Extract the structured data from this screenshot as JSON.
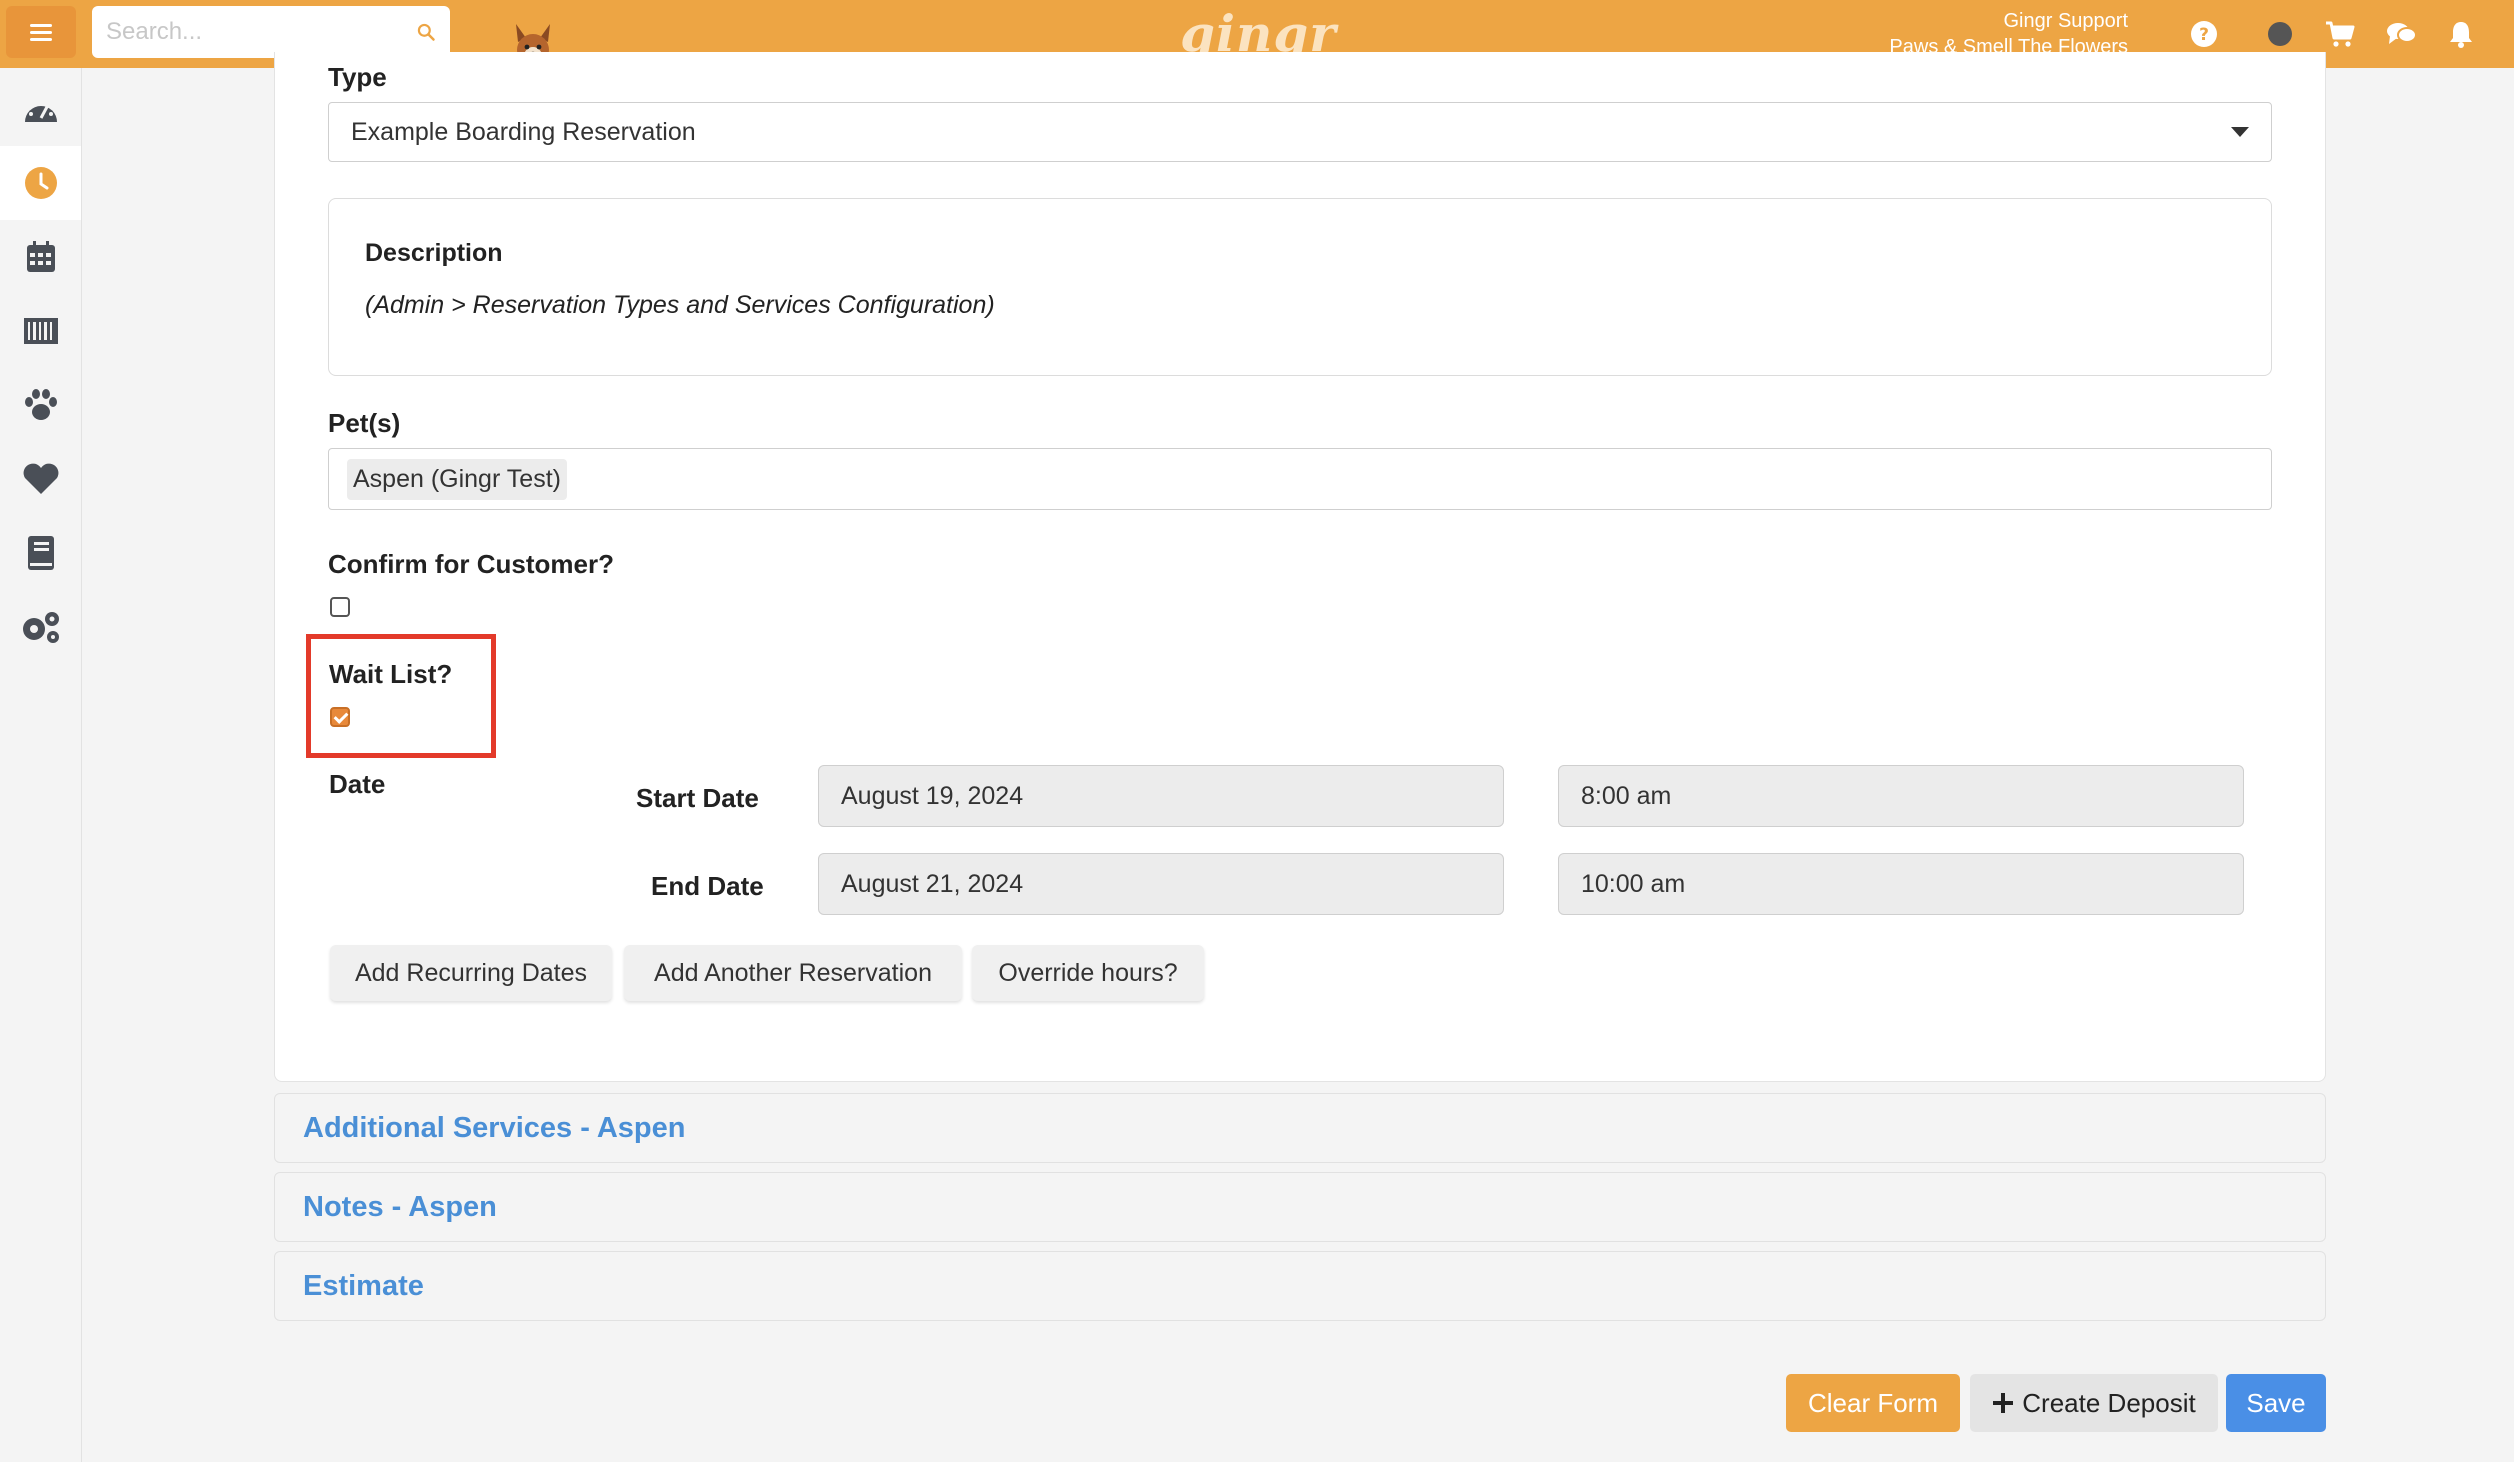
{
  "topbar": {
    "search_placeholder": "Search...",
    "logo": "gingr",
    "user_name": "Gingr Support",
    "business_name": "Paws & Smell The Flowers",
    "accent_color": "#eda544"
  },
  "sidebar": {
    "items": [
      {
        "icon": "dashboard-icon"
      },
      {
        "icon": "clock-icon",
        "active": true
      },
      {
        "icon": "calendar-icon"
      },
      {
        "icon": "barcode-icon"
      },
      {
        "icon": "paw-icon"
      },
      {
        "icon": "heart-icon"
      },
      {
        "icon": "book-icon"
      },
      {
        "icon": "gears-icon"
      }
    ]
  },
  "form": {
    "type_label": "Type",
    "type_value": "Example Boarding Reservation",
    "description_title": "Description",
    "description_text": "(Admin > Reservation Types and Services Configuration)",
    "pets_label": "Pet(s)",
    "pet_tag": "Aspen (Gingr Test)",
    "confirm_label": "Confirm for Customer?",
    "confirm_checked": false,
    "waitlist_label": "Wait List?",
    "waitlist_checked": true,
    "date_label": "Date",
    "start_label": "Start Date",
    "start_date": "August 19, 2024",
    "start_time": "8:00 am",
    "end_label": "End Date",
    "end_date": "August 21, 2024",
    "end_time": "10:00 am",
    "btn_recurring": "Add Recurring Dates",
    "btn_another": "Add Another Reservation",
    "btn_override": "Override hours?"
  },
  "accordions": [
    {
      "title": "Additional Services - Aspen"
    },
    {
      "title": "Notes - Aspen"
    },
    {
      "title": "Estimate"
    }
  ],
  "actions": {
    "clear": "Clear Form",
    "deposit": "Create Deposit",
    "save": "Save"
  }
}
